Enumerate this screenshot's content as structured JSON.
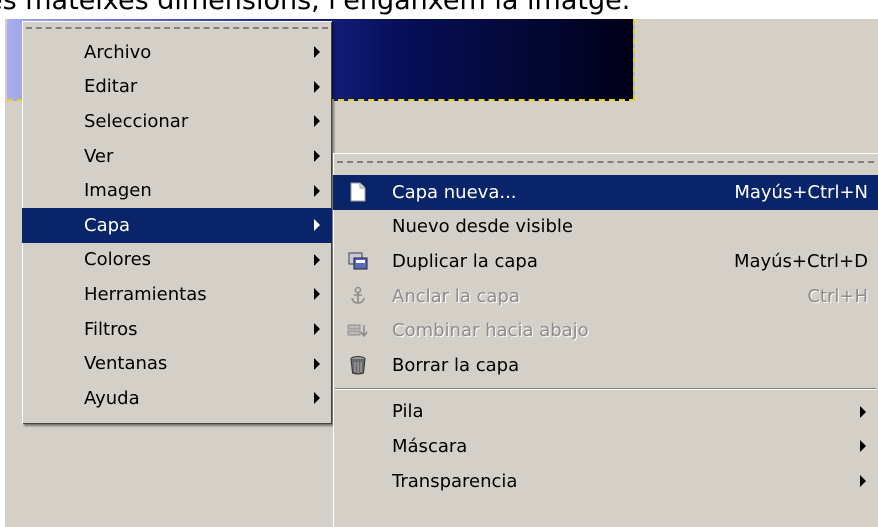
{
  "caption": "es mateixes dimensions, l'enganxem la imatge.",
  "main_menu": {
    "items": [
      {
        "label": "Archivo",
        "has_submenu": true
      },
      {
        "label": "Editar",
        "has_submenu": true
      },
      {
        "label": "Seleccionar",
        "has_submenu": true
      },
      {
        "label": "Ver",
        "has_submenu": true
      },
      {
        "label": "Imagen",
        "has_submenu": true
      },
      {
        "label": "Capa",
        "has_submenu": true,
        "highlighted": true
      },
      {
        "label": "Colores",
        "has_submenu": true
      },
      {
        "label": "Herramientas",
        "has_submenu": true
      },
      {
        "label": "Filtros",
        "has_submenu": true
      },
      {
        "label": "Ventanas",
        "has_submenu": true
      },
      {
        "label": "Ayuda",
        "has_submenu": true
      }
    ]
  },
  "layer_menu": {
    "items": [
      {
        "label": "Capa nueva...",
        "shortcut": "Mayús+Ctrl+N",
        "icon": "new-page-icon",
        "highlighted": true
      },
      {
        "label": "Nuevo desde visible",
        "shortcut": "",
        "icon": ""
      },
      {
        "label": "Duplicar la capa",
        "shortcut": "Mayús+Ctrl+D",
        "icon": "duplicate-layer-icon"
      },
      {
        "label": "Anclar la capa",
        "shortcut": "Ctrl+H",
        "icon": "anchor-icon",
        "disabled": true
      },
      {
        "label": "Combinar hacia abajo",
        "shortcut": "",
        "icon": "merge-down-icon",
        "disabled": true
      },
      {
        "label": "Borrar la capa",
        "shortcut": "",
        "icon": "trash-icon"
      }
    ],
    "submenus": [
      {
        "label": "Pila"
      },
      {
        "label": "Máscara"
      },
      {
        "label": "Transparencia"
      }
    ]
  },
  "colors": {
    "menu_bg": "#d4d0c8",
    "highlight": "#0a246a",
    "disabled_text": "#8c8c8c",
    "selection_marquee": "#e8d400"
  }
}
